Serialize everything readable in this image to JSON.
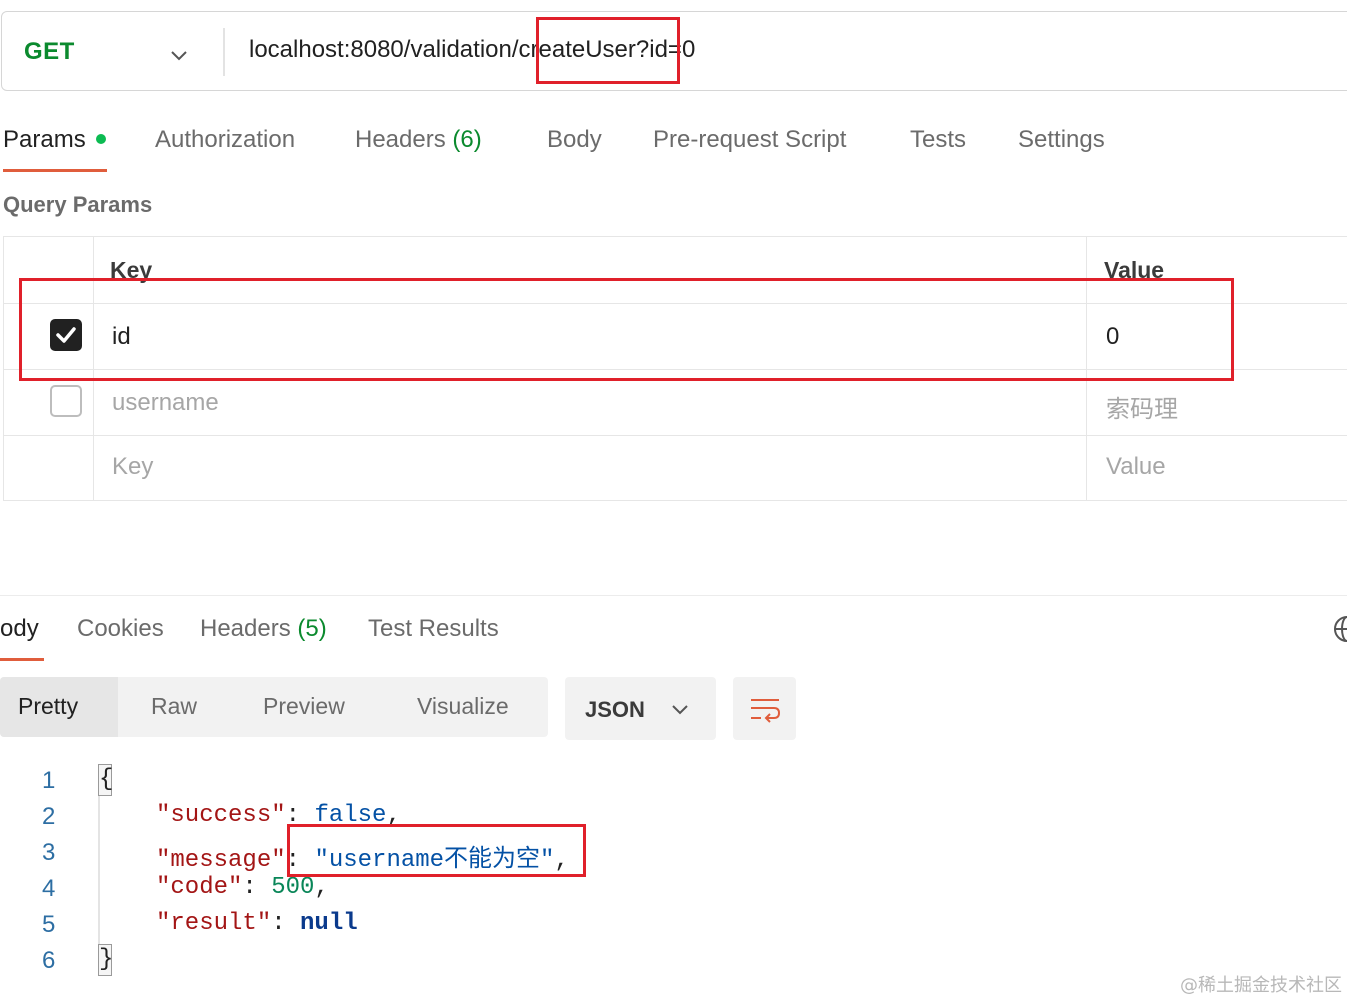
{
  "request": {
    "method": "GET",
    "url": "localhost:8080/validation/createUser?id=0"
  },
  "request_tabs": {
    "params": "Params",
    "authorization": "Authorization",
    "headers": "Headers",
    "headers_count": "(6)",
    "body": "Body",
    "pre_request_script": "Pre-request Script",
    "tests": "Tests",
    "settings": "Settings"
  },
  "query_params": {
    "title": "Query Params",
    "col_key": "Key",
    "col_value": "Value",
    "rows": [
      {
        "key": "id",
        "value": "0",
        "checked": true
      },
      {
        "key": "username",
        "value": "索码理",
        "checked": false
      }
    ],
    "new_key_placeholder": "Key",
    "new_value_placeholder": "Value"
  },
  "response_tabs": {
    "body": "ody",
    "cookies": "Cookies",
    "headers": "Headers",
    "headers_count": "(5)",
    "test_results": "Test Results"
  },
  "view_modes": {
    "pretty": "Pretty",
    "raw": "Raw",
    "preview": "Preview",
    "visualize": "Visualize",
    "format": "JSON"
  },
  "response_body": {
    "line_numbers": [
      "1",
      "2",
      "3",
      "4",
      "5",
      "6"
    ],
    "open_brace": "{",
    "close_brace": "}",
    "success_key": "\"success\"",
    "success_value": "false",
    "message_key": "\"message\"",
    "message_value": "\"username不能为空\"",
    "code_key": "\"code\"",
    "code_value": "500",
    "result_key": "\"result\"",
    "result_value": "null"
  },
  "colors": {
    "method_green": "#0b8a2e",
    "tab_underline": "#e05d3c",
    "highlight_red": "#e0202a"
  },
  "watermark": "@稀土掘金技术社区"
}
